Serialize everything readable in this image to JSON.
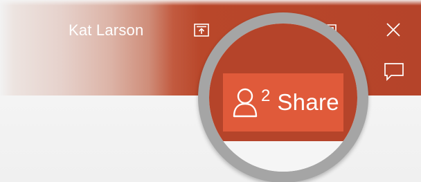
{
  "window": {
    "user_name": "Kat Larson"
  },
  "title_bar": {
    "accent_color": "#b5442a",
    "buttons": [
      {
        "name": "ribbon-display-options",
        "icon": "ribbon-display-icon"
      },
      {
        "name": "restore-down",
        "icon": "restore-icon"
      },
      {
        "name": "close",
        "icon": "close-icon"
      },
      {
        "name": "comments",
        "icon": "comment-icon"
      }
    ]
  },
  "share": {
    "label": "Share",
    "count": "2",
    "icon": "person-icon",
    "color": "#e05a3a"
  },
  "magnifier": {
    "ring_color": "#a5a5a5"
  }
}
